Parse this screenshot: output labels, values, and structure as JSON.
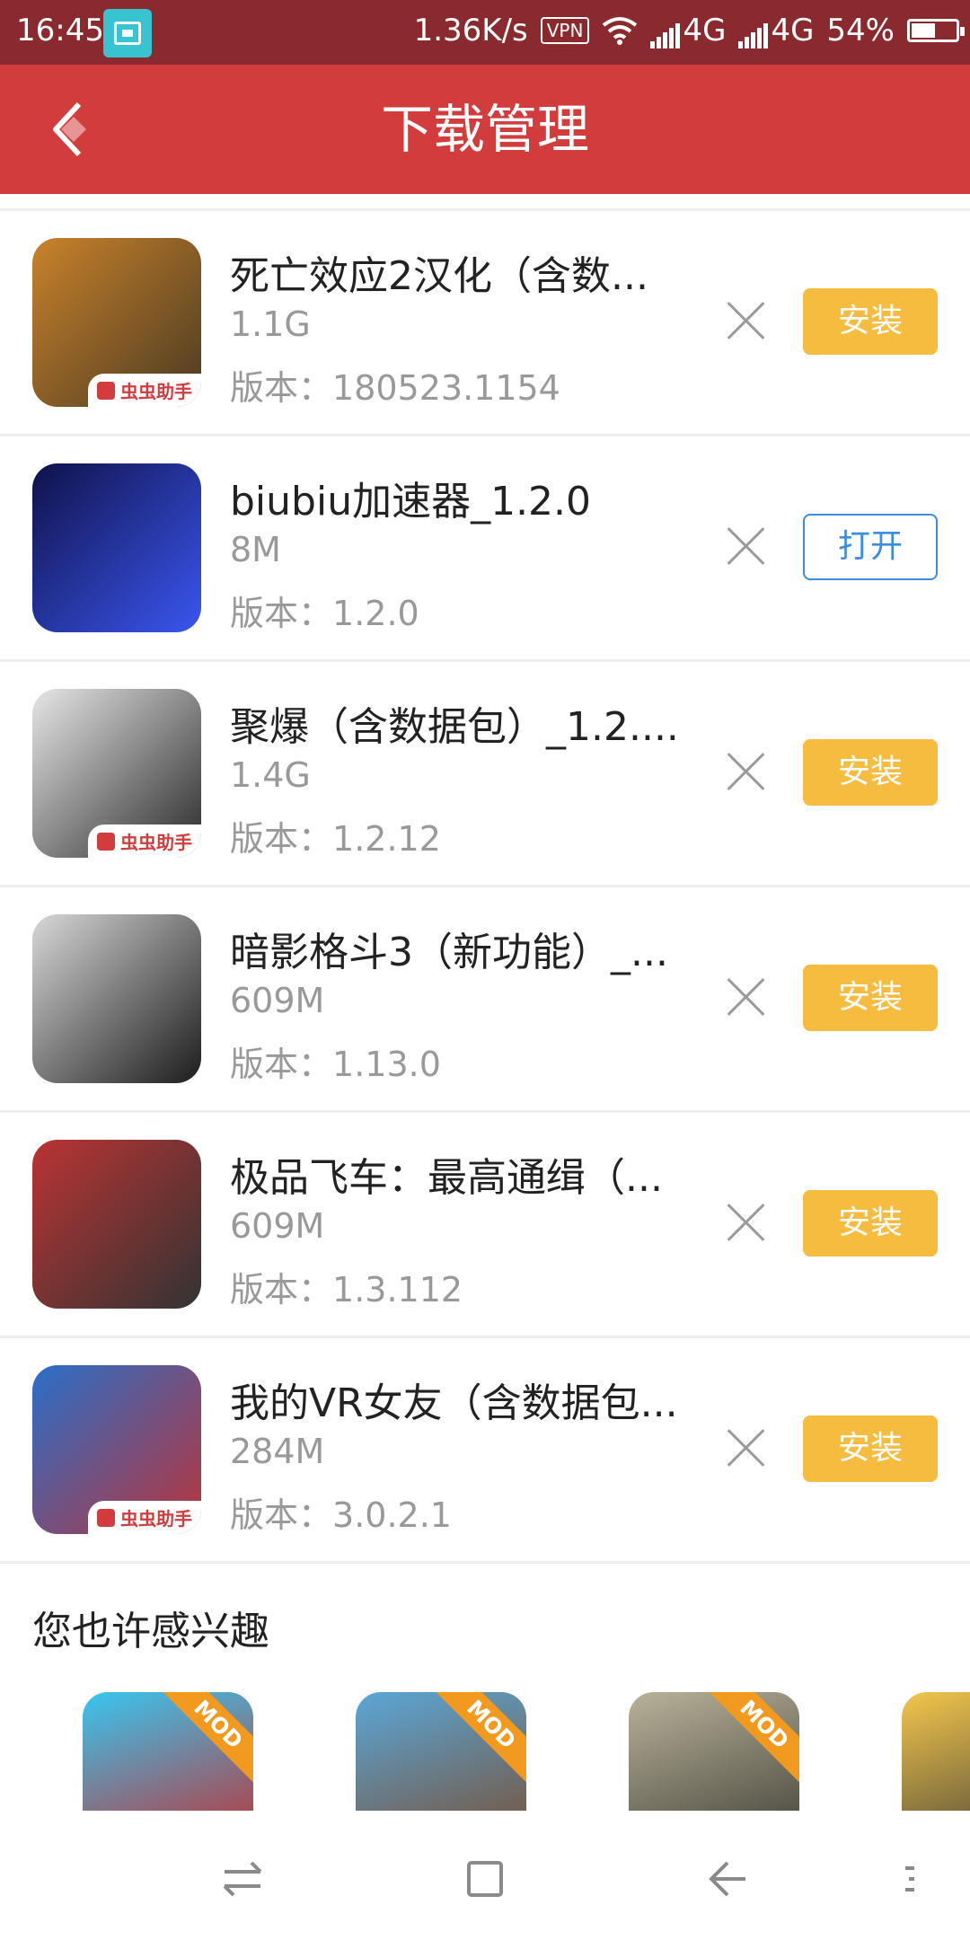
{
  "status_bar": {
    "time": "16:45",
    "speed": "1.36K/s",
    "vpn": "VPN",
    "net1": "4G",
    "net2": "4G",
    "battery": "54%",
    "battery_level": 0.54
  },
  "header": {
    "title": "下载管理",
    "back_icon": "back-arrow-icon"
  },
  "downloads": [
    {
      "name": "死亡效应2汉化（含数...",
      "size": "1.1G",
      "version_label": "版本：",
      "version": "180523.1154",
      "action": "安装",
      "action_type": "install",
      "badge": "虫虫助手",
      "icon_colors": [
        "#c9822b",
        "#4a3a22"
      ]
    },
    {
      "name": "biubiu加速器_1.2.0",
      "size": "8M",
      "version_label": "版本：",
      "version": "1.2.0",
      "action": "打开",
      "action_type": "open",
      "badge": "",
      "icon_colors": [
        "#10124a",
        "#3a56f0"
      ]
    },
    {
      "name": "聚爆（含数据包）_1.2....",
      "size": "1.4G",
      "version_label": "版本：",
      "version": "1.2.12",
      "action": "安装",
      "action_type": "install",
      "badge": "虫虫助手",
      "icon_colors": [
        "#e6e6e6",
        "#2a2a2a"
      ]
    },
    {
      "name": "暗影格斗3（新功能）_...",
      "size": "609M",
      "version_label": "版本：",
      "version": "1.13.0",
      "action": "安装",
      "action_type": "install",
      "badge": "",
      "icon_colors": [
        "#d8d8d8",
        "#1c1c1c"
      ]
    },
    {
      "name": "极品飞车：最高通缉（...",
      "size": "609M",
      "version_label": "版本：",
      "version": "1.3.112",
      "action": "安装",
      "action_type": "install",
      "badge": "",
      "icon_colors": [
        "#b33",
        "#333"
      ]
    },
    {
      "name": "我的VR女友（含数据包...",
      "size": "284M",
      "version_label": "版本：",
      "version": "3.0.2.1",
      "action": "安装",
      "action_type": "install",
      "badge": "虫虫助手",
      "icon_colors": [
        "#2a6fc9",
        "#b8343a"
      ]
    }
  ],
  "recommend": {
    "title": "您也许感兴趣",
    "items": [
      {
        "tag": "MOD",
        "colors": [
          "#38c6f0",
          "#c62828"
        ]
      },
      {
        "tag": "MOD",
        "colors": [
          "#5aa7d8",
          "#7a4a2a"
        ]
      },
      {
        "tag": "MOD",
        "colors": [
          "#b9b29a",
          "#3a3a32"
        ]
      },
      {
        "tag": "",
        "colors": [
          "#f3c64c",
          "#333"
        ]
      }
    ]
  },
  "nav_bar": {
    "icons": [
      "menu-switch-icon",
      "home-square-icon",
      "back-icon",
      "more-icon"
    ]
  }
}
